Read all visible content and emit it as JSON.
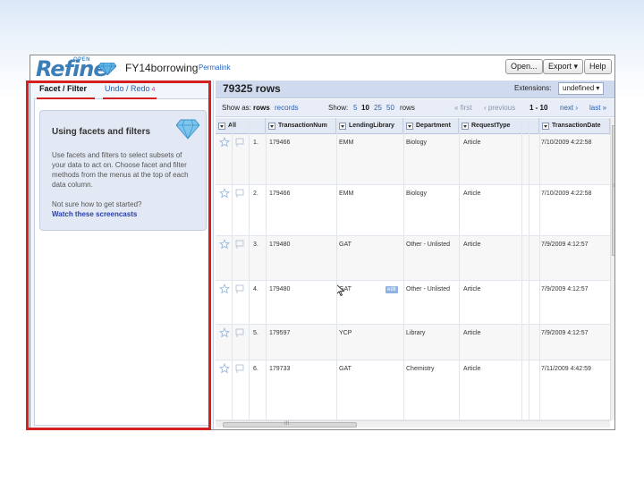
{
  "header": {
    "logo_badge": "OPEN",
    "logo_text": "Refine",
    "project_name": "FY14borrowing",
    "permalink": "Permalink",
    "buttons": {
      "open": "Open...",
      "export": "Export ▾",
      "help": "Help"
    }
  },
  "left_panel": {
    "tabs": {
      "facet": "Facet / Filter",
      "undo": "Undo / Redo",
      "undo_count": "4"
    },
    "help": {
      "title": "Using facets and filters",
      "body": "Use facets and filters to select subsets of your data to act on. Choose facet and filter methods from the menus at the top of each data column.",
      "prompt": "Not sure how to get started?",
      "link": "Watch these screencasts"
    }
  },
  "summary": {
    "row_count": "79325 rows",
    "extensions_label": "Extensions:",
    "extensions_value": "undefined ▾"
  },
  "view_bar": {
    "show_as": "Show as:",
    "rows": "rows",
    "records": "records",
    "show": "Show:",
    "sizes": [
      "5",
      "10",
      "25",
      "50"
    ],
    "rows_suffix": "rows",
    "first": "« first",
    "previous": "‹ previous",
    "range": "1 - 10",
    "next": "next ›",
    "last": "last »"
  },
  "table": {
    "all_label": "All",
    "columns": [
      "TransactionNum",
      "LendingLibrary",
      "Department",
      "RequestType",
      "TransactionDate"
    ],
    "rows": [
      {
        "n": "1.",
        "cells": [
          "179466",
          "EMM",
          "Biology",
          "Article",
          "7/10/2009 4:22:58"
        ]
      },
      {
        "n": "2.",
        "cells": [
          "179466",
          "EMM",
          "Biology",
          "Article",
          "7/10/2009 4:22:58"
        ]
      },
      {
        "n": "3.",
        "cells": [
          "179480",
          "GAT",
          "Other - Unlisted",
          "Article",
          "7/9/2009 4:12:57"
        ]
      },
      {
        "n": "4.",
        "cells": [
          "179480",
          "GAT",
          "Other - Unlisted",
          "Article",
          "7/9/2009 4:12:57"
        ]
      },
      {
        "n": "5.",
        "cells": [
          "179597",
          "YCP",
          "Library",
          "Article",
          "7/9/2009 4:12:57"
        ]
      },
      {
        "n": "6.",
        "cells": [
          "179733",
          "GAT",
          "Chemistry",
          "Article",
          "7/11/2009 4:42:59"
        ]
      }
    ],
    "edit_label": "edit",
    "hscroll_grip": "III",
    "vscroll_grip": "≡"
  },
  "colors": {
    "accent": "#2a62b3",
    "highlight_box": "#d42020",
    "panel_bg": "#f1f5fc"
  }
}
